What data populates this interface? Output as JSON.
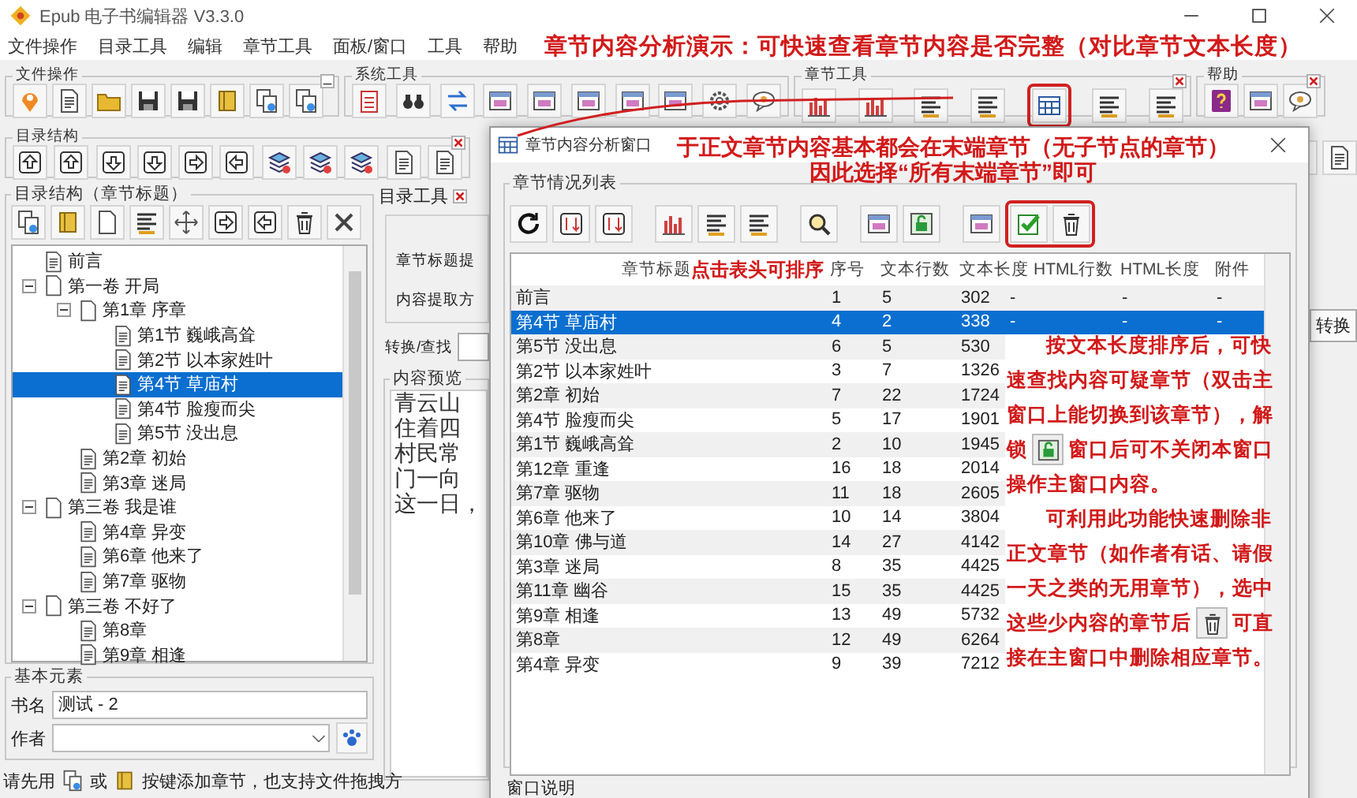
{
  "window": {
    "title": "Epub 电子书编辑器 V3.3.0"
  },
  "menu": [
    "文件操作",
    "目录工具",
    "编辑",
    "章节工具",
    "面板/窗口",
    "工具",
    "帮助"
  ],
  "headline": "章节内容分析演示：可快速查看章节内容是否完整（对比章节文本长度）",
  "toolbar_groups": [
    "文件操作",
    "系统工具",
    "章节工具",
    "帮助"
  ],
  "toolbar2_group": "目录结构",
  "tree_panel": {
    "title": "目录结构（章节标题）",
    "items": [
      {
        "label": "前言",
        "selected": false
      },
      {
        "label": "第一卷 开局",
        "selected": false,
        "expanded": true,
        "children": [
          {
            "label": "第1章 序章",
            "selected": false,
            "expanded": true,
            "children": [
              {
                "label": "第1节 巍峨高耸",
                "selected": false
              },
              {
                "label": "第2节 以本家姓叶",
                "selected": false
              },
              {
                "label": "第4节 草庙村",
                "selected": true
              },
              {
                "label": "第4节 脸瘦而尖",
                "selected": false
              },
              {
                "label": "第5节 没出息",
                "selected": false
              }
            ]
          },
          {
            "label": "第2章 初始",
            "selected": false
          },
          {
            "label": "第3章 迷局",
            "selected": false
          }
        ]
      },
      {
        "label": "第三卷 我是谁",
        "selected": false,
        "expanded": true,
        "children": [
          {
            "label": "第4章 异变",
            "selected": false
          },
          {
            "label": "第6章 他来了",
            "selected": false
          },
          {
            "label": "第7章 驱物",
            "selected": false
          }
        ]
      },
      {
        "label": "第三卷 不好了",
        "selected": false,
        "expanded": true,
        "children": [
          {
            "label": "第8章",
            "selected": false
          },
          {
            "label": "第9章 相逢",
            "selected": false
          }
        ]
      }
    ]
  },
  "basic": {
    "title": "基本元素",
    "book_label": "书名",
    "book_value": "测试 - 2",
    "author_label": "作者"
  },
  "tool_panel": {
    "title": "目录工具",
    "labels": [
      "章节标题提",
      "内容提取方"
    ],
    "find_label": "转换/查找",
    "preview_title": "内容预览",
    "preview_lines": [
      "青云山",
      "住着四",
      "村民常",
      "门一向",
      "这一日，"
    ]
  },
  "right_strip": {
    "button": "转换"
  },
  "status": {
    "before": "请先用",
    "middle": "或",
    "after": "按键添加章节，也支持文件拖拽方"
  },
  "dialog": {
    "title": "章节内容分析窗口",
    "note": [
      "于正文章节内容基本都会在末端章节（无子节点的章节）",
      "因此选择“所有末端章节”即可"
    ],
    "group": "章节情况列表",
    "header_note": "点击表头可排序",
    "columns": [
      "章节标题",
      "序号",
      "文本行数",
      "文本长度",
      "HTML行数",
      "HTML长度",
      "附件"
    ],
    "rows": [
      {
        "cells": [
          "前言",
          "1",
          "5",
          "302",
          "-",
          "-",
          "-"
        ],
        "selected": false
      },
      {
        "cells": [
          "第4节 草庙村",
          "4",
          "2",
          "338",
          "-",
          "-",
          "-"
        ],
        "selected": true
      },
      {
        "cells": [
          "第5节 没出息",
          "6",
          "5",
          "530"
        ],
        "selected": false
      },
      {
        "cells": [
          "第2节 以本家姓叶",
          "3",
          "7",
          "1326"
        ],
        "selected": false
      },
      {
        "cells": [
          "第2章 初始",
          "7",
          "22",
          "1724"
        ],
        "selected": false
      },
      {
        "cells": [
          "第4节 脸瘦而尖",
          "5",
          "17",
          "1901"
        ],
        "selected": false
      },
      {
        "cells": [
          "第1节 巍峨高耸",
          "2",
          "10",
          "1945"
        ],
        "selected": false
      },
      {
        "cells": [
          "第12章 重逢",
          "16",
          "18",
          "2014"
        ],
        "selected": false
      },
      {
        "cells": [
          "第7章 驱物",
          "11",
          "18",
          "2605"
        ],
        "selected": false
      },
      {
        "cells": [
          "第6章 他来了",
          "10",
          "14",
          "3804"
        ],
        "selected": false
      },
      {
        "cells": [
          "第10章 佛与道",
          "14",
          "27",
          "4142"
        ],
        "selected": false
      },
      {
        "cells": [
          "第3章 迷局",
          "8",
          "35",
          "4425"
        ],
        "selected": false
      },
      {
        "cells": [
          "第11章 幽谷",
          "15",
          "35",
          "4425"
        ],
        "selected": false
      },
      {
        "cells": [
          "第9章 相逢",
          "13",
          "49",
          "5732"
        ],
        "selected": false
      },
      {
        "cells": [
          "第8章",
          "12",
          "49",
          "6264"
        ],
        "selected": false
      },
      {
        "cells": [
          "第4章 异变",
          "9",
          "39",
          "7212"
        ],
        "selected": false
      }
    ],
    "side_notes": [
      {
        "kind": "lead",
        "text": "按文本长度排序后，可快"
      },
      {
        "kind": "text",
        "text": "速查找内容可疑章节（双击主"
      },
      {
        "kind": "text",
        "text": "窗口上能切换到该章节），解"
      },
      {
        "kind": "unlock",
        "before": "锁",
        "after": "窗口后可不关闭本窗口"
      },
      {
        "kind": "text",
        "text": "操作主窗口内容。"
      },
      {
        "kind": "lead",
        "text": "可利用此功能快速删除非"
      },
      {
        "kind": "text",
        "text": "正文章节（如作者有话、请假"
      },
      {
        "kind": "text",
        "text": "一天之类的无用章节），选中"
      },
      {
        "kind": "delete",
        "before": "这些少内容的章节后",
        "after": "可直"
      },
      {
        "kind": "text",
        "text": "接在主窗口中删除相应章节。"
      }
    ],
    "footer_group": "窗口说明"
  }
}
